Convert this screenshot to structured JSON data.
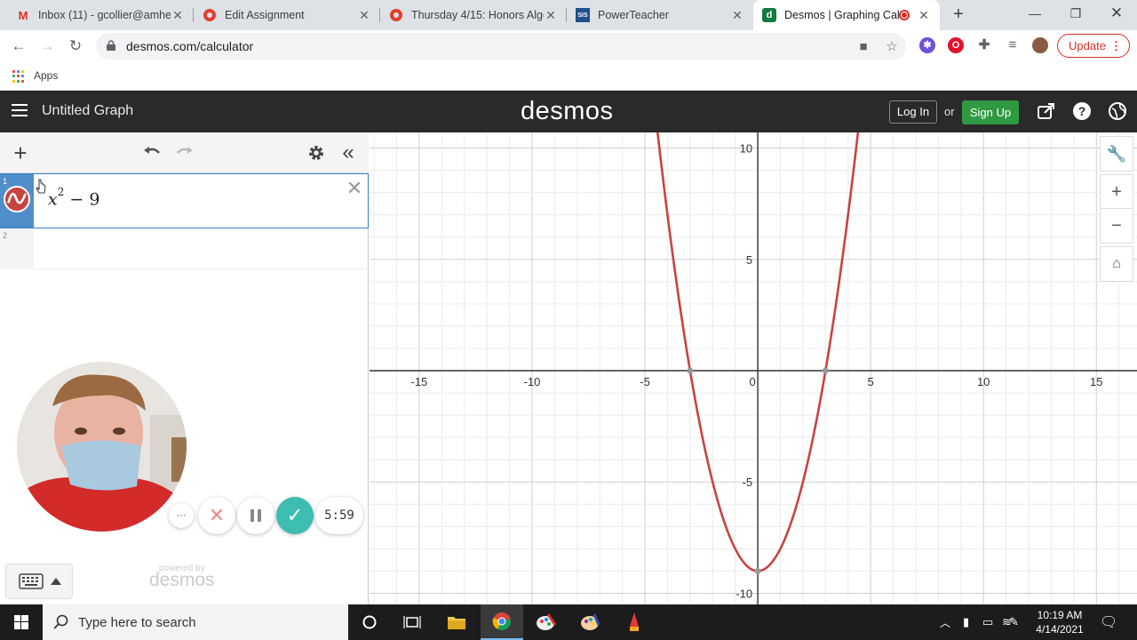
{
  "browser": {
    "tabs": [
      {
        "title": "Inbox (11) - gcollier@amhe",
        "icon": "gmail-icon",
        "active": false
      },
      {
        "title": "Edit Assignment",
        "icon": "canvas-icon",
        "active": false
      },
      {
        "title": "Thursday 4/15: Honors Alge",
        "icon": "canvas-icon",
        "active": false
      },
      {
        "title": "PowerTeacher",
        "icon": "sis-icon",
        "active": false
      },
      {
        "title": "Desmos | Graphing Cal",
        "icon": "desmos-icon",
        "active": true
      }
    ],
    "url": "desmos.com/calculator",
    "update_label": "Update",
    "bookmarks": {
      "apps_label": "Apps"
    }
  },
  "desmos": {
    "graph_title": "Untitled Graph",
    "brand": "desmos",
    "login_label": "Log In",
    "or_label": "or",
    "signup_label": "Sign Up",
    "expressions": [
      {
        "index": "1",
        "base": "x",
        "exponent": "2",
        "rest": " − 9",
        "color": "#c74440"
      },
      {
        "index": "2"
      }
    ],
    "powered_by": "powered by",
    "powered_brand": "desmos"
  },
  "recorder": {
    "timer": "5:59",
    "more_label": "···"
  },
  "chart_data": {
    "type": "line",
    "title": "",
    "function": "y = x^2 - 9",
    "xlim": [
      -17.2,
      16.8
    ],
    "ylim": [
      -10.5,
      10.7
    ],
    "x_ticks": [
      -15,
      -10,
      -5,
      0,
      5,
      10,
      15
    ],
    "y_ticks": [
      -10,
      -5,
      5,
      10
    ],
    "minor_grid_step": 1,
    "major_grid_step": 5,
    "grid": true,
    "series": [
      {
        "color": "#c74440",
        "points": [
          [
            -4.5,
            11.25
          ],
          [
            -4,
            7
          ],
          [
            -3,
            0
          ],
          [
            -2,
            -5
          ],
          [
            -1,
            -8
          ],
          [
            0,
            -9
          ],
          [
            1,
            -8
          ],
          [
            2,
            -5
          ],
          [
            3,
            0
          ],
          [
            4,
            7
          ],
          [
            4.5,
            11.25
          ]
        ]
      }
    ],
    "marked_points": [
      [
        -3,
        0
      ],
      [
        3,
        0
      ],
      [
        0,
        -9
      ]
    ]
  },
  "taskbar": {
    "search_placeholder": "Type here to search",
    "time": "10:19 AM",
    "date": "4/14/2021"
  }
}
